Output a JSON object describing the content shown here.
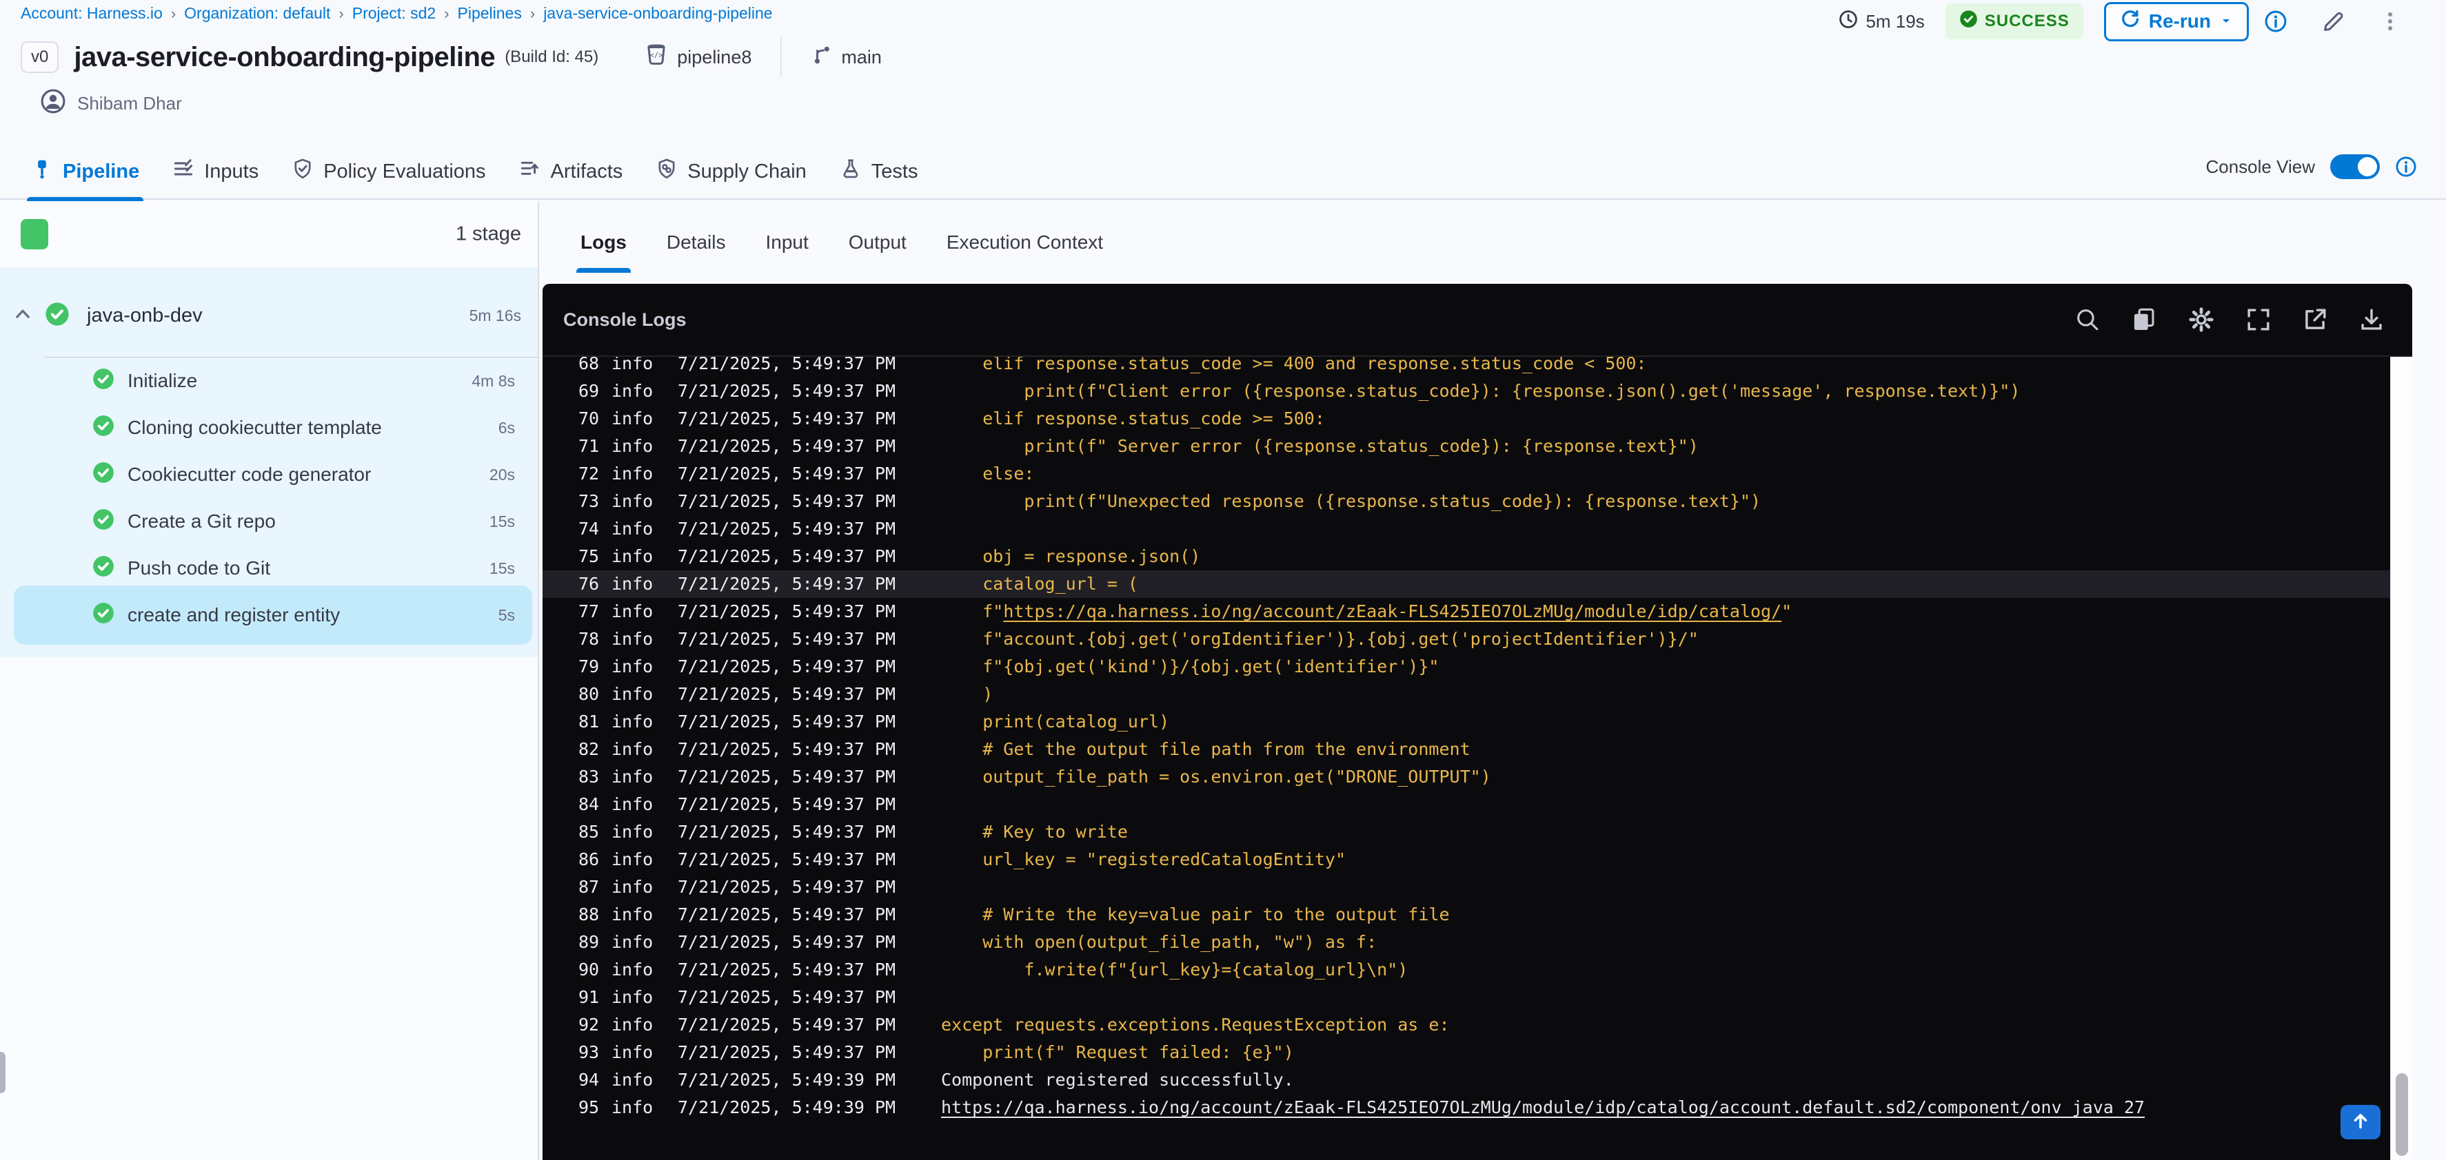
{
  "colors": {
    "accent_blue": "#0278d5",
    "status_green": "#42c467",
    "success_bg": "#e4f7e4",
    "success_text": "#1b841d",
    "log_yellow": "#e9b64b",
    "log_white": "#e6e7ec",
    "console_bg": "#0b0b0d",
    "selected_step_bg": "#c3eafb",
    "stage_block_bg": "#e9f6fd",
    "scroll_top_bg": "#1a6fd6"
  },
  "breadcrumb": {
    "separator": "›",
    "items": [
      "Account: Harness.io",
      "Organization: default",
      "Project: sd2",
      "Pipelines",
      "java-service-onboarding-pipeline"
    ]
  },
  "header": {
    "duration": "5m 19s",
    "status": "SUCCESS",
    "rerun_label": "Re-run",
    "version_badge": "v0",
    "title": "java-service-onboarding-pipeline",
    "build_id": "(Build Id: 45)",
    "pipeline_ref": "pipeline8",
    "branch": "main",
    "owner": "Shibam Dhar"
  },
  "tabs": [
    {
      "label": "Pipeline",
      "active": true,
      "icon": "pipeline-icon"
    },
    {
      "label": "Inputs",
      "active": false,
      "icon": "inputs-icon"
    },
    {
      "label": "Policy Evaluations",
      "active": false,
      "icon": "policy-shield-icon"
    },
    {
      "label": "Artifacts",
      "active": false,
      "icon": "artifacts-icon"
    },
    {
      "label": "Supply Chain",
      "active": false,
      "icon": "supply-chain-shield-icon"
    },
    {
      "label": "Tests",
      "active": false,
      "icon": "tests-flask-icon"
    }
  ],
  "console_view": {
    "label": "Console View",
    "enabled": true
  },
  "sidebar": {
    "stage_count": "1 stage",
    "stage": {
      "name": "java-onb-dev",
      "duration": "5m 16s"
    },
    "steps": [
      {
        "name": "Initialize",
        "duration": "4m 8s",
        "selected": false
      },
      {
        "name": "Cloning cookiecutter template",
        "duration": "6s",
        "selected": false
      },
      {
        "name": "Cookiecutter code generator",
        "duration": "20s",
        "selected": false
      },
      {
        "name": "Create a Git repo",
        "duration": "15s",
        "selected": false
      },
      {
        "name": "Push code to Git",
        "duration": "15s",
        "selected": false
      },
      {
        "name": "create and register entity",
        "duration": "5s",
        "selected": true
      }
    ]
  },
  "detail_tabs": {
    "items": [
      "Logs",
      "Details",
      "Input",
      "Output",
      "Execution Context"
    ],
    "active": "Logs"
  },
  "console": {
    "title": "Console Logs",
    "icons": [
      "search-icon",
      "copy-icon",
      "settings-icon",
      "fullscreen-icon",
      "open-in-new-icon",
      "download-icon"
    ],
    "logs": [
      {
        "n": 68,
        "level": "info",
        "time": "7/21/2025, 5:49:37 PM",
        "c": "y",
        "hl": false,
        "m": [
          {
            "t": "    elif response.status_code >= 400 and response.status_code < 500:"
          }
        ]
      },
      {
        "n": 69,
        "level": "info",
        "time": "7/21/2025, 5:49:37 PM",
        "c": "y",
        "hl": false,
        "m": [
          {
            "t": "        print(f\"Client error ({response.status_code}): {response.json().get('message', response.text)}\")"
          }
        ]
      },
      {
        "n": 70,
        "level": "info",
        "time": "7/21/2025, 5:49:37 PM",
        "c": "y",
        "hl": false,
        "m": [
          {
            "t": "    elif response.status_code >= 500:"
          }
        ]
      },
      {
        "n": 71,
        "level": "info",
        "time": "7/21/2025, 5:49:37 PM",
        "c": "y",
        "hl": false,
        "m": [
          {
            "t": "        print(f\" Server error ({response.status_code}): {response.text}\")"
          }
        ]
      },
      {
        "n": 72,
        "level": "info",
        "time": "7/21/2025, 5:49:37 PM",
        "c": "y",
        "hl": false,
        "m": [
          {
            "t": "    else:"
          }
        ]
      },
      {
        "n": 73,
        "level": "info",
        "time": "7/21/2025, 5:49:37 PM",
        "c": "y",
        "hl": false,
        "m": [
          {
            "t": "        print(f\"Unexpected response ({response.status_code}): {response.text}\")"
          }
        ]
      },
      {
        "n": 74,
        "level": "info",
        "time": "7/21/2025, 5:49:37 PM",
        "c": "y",
        "hl": false,
        "m": [
          {
            "t": ""
          }
        ]
      },
      {
        "n": 75,
        "level": "info",
        "time": "7/21/2025, 5:49:37 PM",
        "c": "y",
        "hl": false,
        "m": [
          {
            "t": "    obj = response.json()"
          }
        ]
      },
      {
        "n": 76,
        "level": "info",
        "time": "7/21/2025, 5:49:37 PM",
        "c": "y",
        "hl": true,
        "m": [
          {
            "t": "    catalog_url = ("
          }
        ]
      },
      {
        "n": 77,
        "level": "info",
        "time": "7/21/2025, 5:49:37 PM",
        "c": "y",
        "hl": false,
        "m": [
          {
            "t": "    f\""
          },
          {
            "t": "https://qa.harness.io/ng/account/zEaak-FLS425IEO7OLzMUg/module/idp/catalog/",
            "u": true
          },
          {
            "t": "\""
          }
        ]
      },
      {
        "n": 78,
        "level": "info",
        "time": "7/21/2025, 5:49:37 PM",
        "c": "y",
        "hl": false,
        "m": [
          {
            "t": "    f\"account.{obj.get('orgIdentifier')}.{obj.get('projectIdentifier')}/\""
          }
        ]
      },
      {
        "n": 79,
        "level": "info",
        "time": "7/21/2025, 5:49:37 PM",
        "c": "y",
        "hl": false,
        "m": [
          {
            "t": "    f\"{obj.get('kind')}/{obj.get('identifier')}\""
          }
        ]
      },
      {
        "n": 80,
        "level": "info",
        "time": "7/21/2025, 5:49:37 PM",
        "c": "y",
        "hl": false,
        "m": [
          {
            "t": "    )"
          }
        ]
      },
      {
        "n": 81,
        "level": "info",
        "time": "7/21/2025, 5:49:37 PM",
        "c": "y",
        "hl": false,
        "m": [
          {
            "t": "    print(catalog_url)"
          }
        ]
      },
      {
        "n": 82,
        "level": "info",
        "time": "7/21/2025, 5:49:37 PM",
        "c": "y",
        "hl": false,
        "m": [
          {
            "t": "    # Get the output file path from the environment"
          }
        ]
      },
      {
        "n": 83,
        "level": "info",
        "time": "7/21/2025, 5:49:37 PM",
        "c": "y",
        "hl": false,
        "m": [
          {
            "t": "    output_file_path = os.environ.get(\"DRONE_OUTPUT\")"
          }
        ]
      },
      {
        "n": 84,
        "level": "info",
        "time": "7/21/2025, 5:49:37 PM",
        "c": "y",
        "hl": false,
        "m": [
          {
            "t": ""
          }
        ]
      },
      {
        "n": 85,
        "level": "info",
        "time": "7/21/2025, 5:49:37 PM",
        "c": "y",
        "hl": false,
        "m": [
          {
            "t": "    # Key to write"
          }
        ]
      },
      {
        "n": 86,
        "level": "info",
        "time": "7/21/2025, 5:49:37 PM",
        "c": "y",
        "hl": false,
        "m": [
          {
            "t": "    url_key = \"registeredCatalogEntity\""
          }
        ]
      },
      {
        "n": 87,
        "level": "info",
        "time": "7/21/2025, 5:49:37 PM",
        "c": "y",
        "hl": false,
        "m": [
          {
            "t": ""
          }
        ]
      },
      {
        "n": 88,
        "level": "info",
        "time": "7/21/2025, 5:49:37 PM",
        "c": "y",
        "hl": false,
        "m": [
          {
            "t": "    # Write the key=value pair to the output file"
          }
        ]
      },
      {
        "n": 89,
        "level": "info",
        "time": "7/21/2025, 5:49:37 PM",
        "c": "y",
        "hl": false,
        "m": [
          {
            "t": "    with open(output_file_path, \"w\") as f:"
          }
        ]
      },
      {
        "n": 90,
        "level": "info",
        "time": "7/21/2025, 5:49:37 PM",
        "c": "y",
        "hl": false,
        "m": [
          {
            "t": "        f.write(f\"{url_key}={catalog_url}\\n\")"
          }
        ]
      },
      {
        "n": 91,
        "level": "info",
        "time": "7/21/2025, 5:49:37 PM",
        "c": "y",
        "hl": false,
        "m": [
          {
            "t": ""
          }
        ]
      },
      {
        "n": 92,
        "level": "info",
        "time": "7/21/2025, 5:49:37 PM",
        "c": "y",
        "hl": false,
        "m": [
          {
            "t": "except requests.exceptions.RequestException as e:"
          }
        ]
      },
      {
        "n": 93,
        "level": "info",
        "time": "7/21/2025, 5:49:37 PM",
        "c": "y",
        "hl": false,
        "m": [
          {
            "t": "    print(f\" Request failed: {e}\")"
          }
        ]
      },
      {
        "n": 94,
        "level": "info",
        "time": "7/21/2025, 5:49:39 PM",
        "c": "w",
        "hl": false,
        "m": [
          {
            "t": "Component registered successfully."
          }
        ]
      },
      {
        "n": 95,
        "level": "info",
        "time": "7/21/2025, 5:49:39 PM",
        "c": "w",
        "hl": false,
        "m": [
          {
            "t": "https://qa.harness.io/ng/account/zEaak-FLS425IEO7OLzMUg/module/idp/catalog/account.default.sd2/component/onv_java_27",
            "u": true
          }
        ]
      }
    ]
  }
}
